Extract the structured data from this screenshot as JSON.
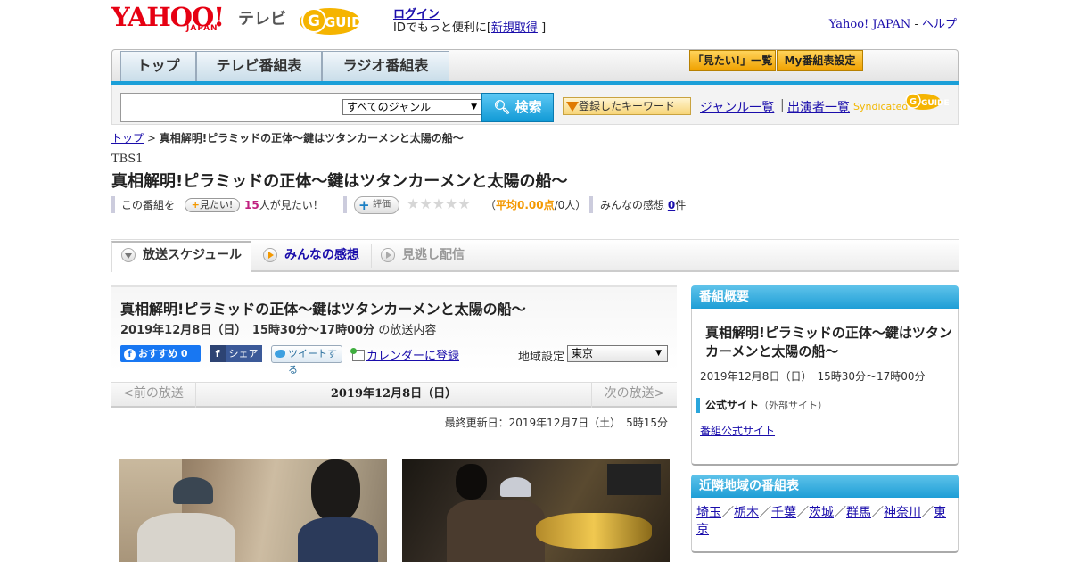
{
  "header": {
    "logo_yahoo": "YAHOO!",
    "logo_japan": "JAPAN",
    "logo_tv": "テレビ",
    "gguide_logo": "G-GUIDE",
    "login": "ログイン",
    "login_prompt": "IDでもっと便利に[",
    "signup": "新規取得",
    "login_suffix": "]",
    "yahoo_japan_link": "Yahoo! JAPAN",
    "dash": " - ",
    "help_link": "ヘルプ"
  },
  "nav": {
    "tabs": [
      "トップ",
      "テレビ番組表",
      "ラジオ番組表"
    ],
    "mitai_list": "「見たい!」一覧",
    "my_schedule": "My番組表設定"
  },
  "search": {
    "genre_select": "すべてのジャンル",
    "button": "検索",
    "keyword_button": "登録したキーワード",
    "genre_list": "ジャンル一覧",
    "separator": "|",
    "performer_list": "出演者一覧",
    "syndicated": "Syndicated",
    "gguide_small": "G-GUIDE"
  },
  "breadcrumb": {
    "top": "トップ",
    "sep": " > ",
    "current": "真相解明!ピラミッドの正体～鍵はツタンカーメンと太陽の船～"
  },
  "program": {
    "channel": "TBS1",
    "title": "真相解明!ピラミッドの正体～鍵はツタンカーメンと太陽の船～",
    "want_prefix": "この番組を",
    "want_button": "見たい!",
    "want_count": "15",
    "want_suffix": "人が見たい！",
    "rate_button": "評価",
    "stars": "★★★★★",
    "rating_open": "（",
    "rating_avg": "平均0.00点",
    "rating_count": "/0人）",
    "impressions_prefix": "みんなの感想",
    "impressions_count": "0",
    "impressions_suffix": "件"
  },
  "tabs": {
    "schedule": "放送スケジュール",
    "impressions": "みんなの感想",
    "vod": "見逃し配信"
  },
  "broadcast": {
    "title": "真相解明!ピラミッドの正体～鍵はツタンカーメンと太陽の船～",
    "datetime": "2019年12月8日（日）　15時30分～17時00分",
    "datetime_suffix": "の放送内容",
    "fb_recommend": "おすすめ 0",
    "fb_share": "シェア",
    "tweet": "ツイートする",
    "calendar": "カレンダーに登録",
    "region_label": "地域設定",
    "region_value": "東京"
  },
  "pager": {
    "prev": "<前の放送",
    "date": "2019年12月8日（日）",
    "next": "次の放送>"
  },
  "updated": "最終更新日：2019年12月7日（土）　5時15分",
  "sidebar": {
    "overview_heading": "番組概要",
    "overview_title": "真相解明!ピラミッドの正体～鍵はツタンカーメンと太陽の船～",
    "overview_date": "2019年12月8日（日）　15時30分～17時00分",
    "official_site": "公式サイト",
    "official_site_note": "（外部サイト）",
    "official_link": "番組公式サイト",
    "neighbor_heading": "近隣地域の番組表",
    "neighbors": [
      "埼玉",
      "栃木",
      "千葉",
      "茨城",
      "群馬",
      "神奈川",
      "東京"
    ],
    "neighbor_sep": "／"
  },
  "colors": {
    "accent_blue": "#1b9fd8",
    "yahoo_red": "#e60012",
    "orange": "#f39800"
  }
}
